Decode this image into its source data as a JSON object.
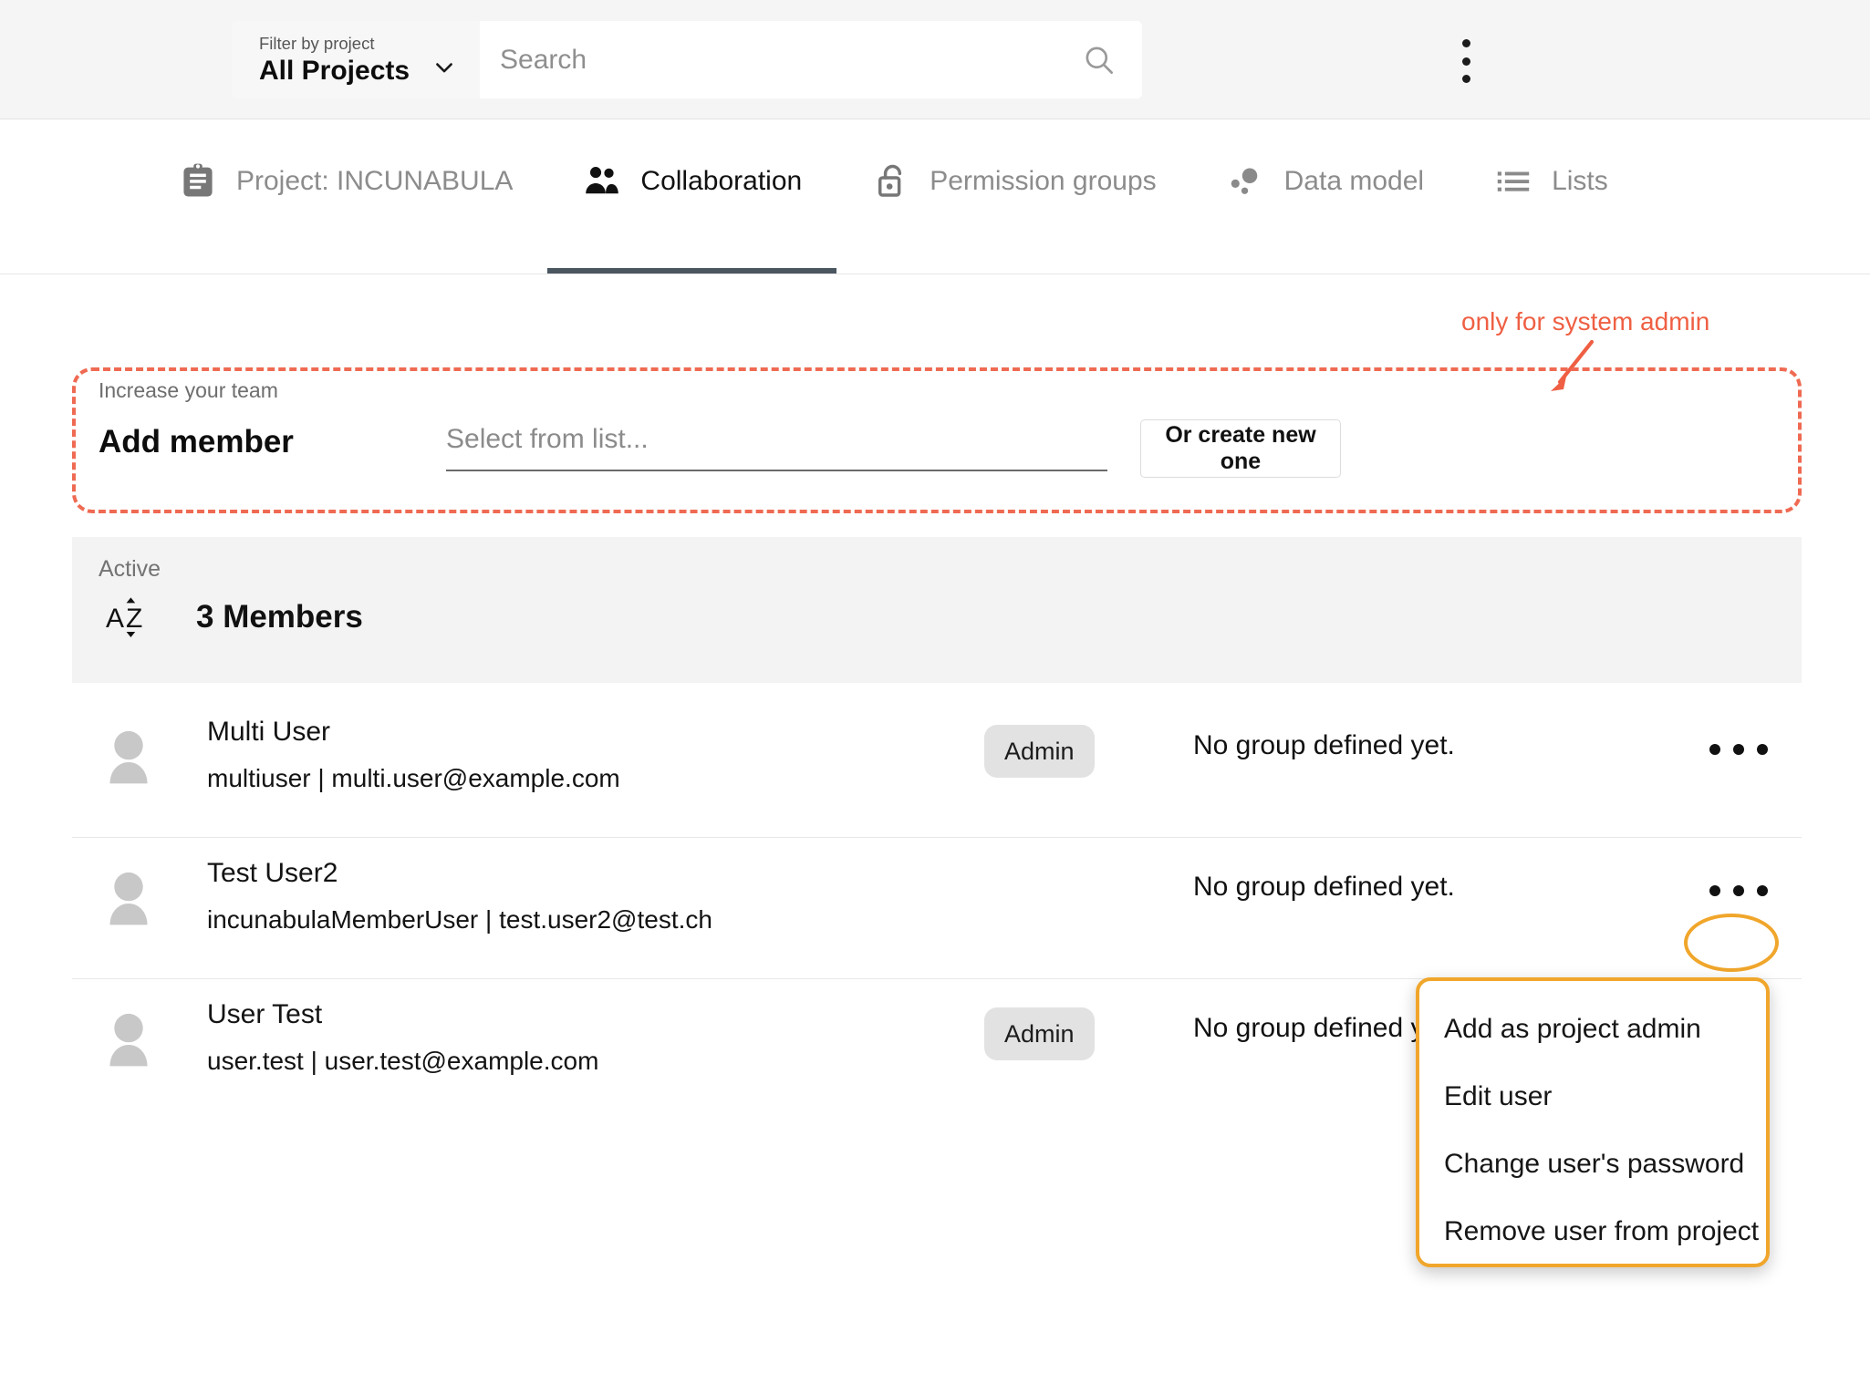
{
  "topbar": {
    "filter_label": "Filter by project",
    "filter_value": "All Projects",
    "search_placeholder": "Search",
    "search_value": ""
  },
  "tabs": [
    {
      "label": "Project: INCUNABULA",
      "icon": "clipboard-icon",
      "active": false
    },
    {
      "label": "Collaboration",
      "icon": "people-icon",
      "active": true
    },
    {
      "label": "Permission groups",
      "icon": "unlock-icon",
      "active": false
    },
    {
      "label": "Data model",
      "icon": "data-model-icon",
      "active": false
    },
    {
      "label": "Lists",
      "icon": "list-icon",
      "active": false
    }
  ],
  "add_member": {
    "eyebrow": "Increase your team",
    "title": "Add member",
    "select_placeholder": "Select from list...",
    "create_button": "Or create new one",
    "annotation": "only for system admin",
    "annotation_color": "#ef5f43",
    "outline_color": "#ef6a52"
  },
  "members_section": {
    "status_label": "Active",
    "count_label": "3 Members",
    "sort_icon": "sort-alpha-icon"
  },
  "members": [
    {
      "name": "Multi User",
      "details": "multiuser | multi.user@example.com",
      "badge": "Admin",
      "group": "No group defined yet."
    },
    {
      "name": "Test User2",
      "details": "incunabulaMemberUser | test.user2@test.ch",
      "badge": "",
      "group": "No group defined yet."
    },
    {
      "name": "User Test",
      "details": "user.test | user.test@example.com",
      "badge": "Admin",
      "group": "No group defined yet."
    }
  ],
  "dropdown": {
    "highlight_color": "#f0a62b",
    "items": [
      "Add as project admin",
      "Edit user",
      "Change user's password",
      "Remove user from project"
    ]
  }
}
